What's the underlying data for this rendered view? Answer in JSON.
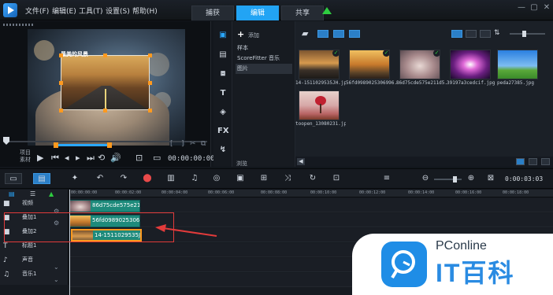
{
  "menu": [
    "文件(F)",
    "编辑(E)",
    "工具(T)",
    "设置(S)",
    "帮助(H)"
  ],
  "mode_tabs": [
    "捕获",
    "编辑",
    "共享"
  ],
  "active_tab": "编辑",
  "player": {
    "video_text": "最美的风景",
    "side_labels": [
      "项目",
      "素材"
    ],
    "timecode": "00:00:00:00"
  },
  "library": {
    "add_label": "添加",
    "folders": [
      "样本",
      "ScoreFitter 音乐",
      "图片"
    ],
    "selected_folder": "图片",
    "browse_label": "浏览",
    "thumbnails": [
      {
        "label": "14-1511029535JH.jpg",
        "checked": true
      },
      {
        "label": "56fd0989025306996.jpg",
        "checked": true
      },
      {
        "label": "86d75cde575e211d5...",
        "checked": true
      },
      {
        "label": "39197a3cedcif.jpg",
        "checked": false
      },
      {
        "label": "peda27385.jpg",
        "checked": false
      },
      {
        "label": "toopen_13080231.jpg",
        "checked": false
      }
    ]
  },
  "timeline": {
    "timecode": "0:00:03:03",
    "ruler_ticks": [
      "00:00:00:00",
      "00:00:02:00",
      "00:00:04:00",
      "00:00:06:00",
      "00:00:08:00",
      "00:00:10:00",
      "00:00:12:00",
      "00:00:14:00",
      "00:00:16:00",
      "00:00:18:00"
    ],
    "tracks": [
      "视频",
      "叠加1",
      "叠加2",
      "标题1",
      "声音",
      "音乐1"
    ],
    "clips": [
      {
        "track": "视频",
        "label": "86d75cde575e211d5"
      },
      {
        "track": "叠加1",
        "label": "56fd09890253069969"
      },
      {
        "track": "叠加2",
        "label": "14-1511029535JH"
      }
    ]
  },
  "watermark": {
    "top": "PConline",
    "bottom": "IT百科"
  },
  "colors": {
    "accent": "#22a4f4",
    "clip": "#1d8a7b",
    "selected_clip": "#ff9a1f",
    "annotation": "#e23b3b"
  }
}
